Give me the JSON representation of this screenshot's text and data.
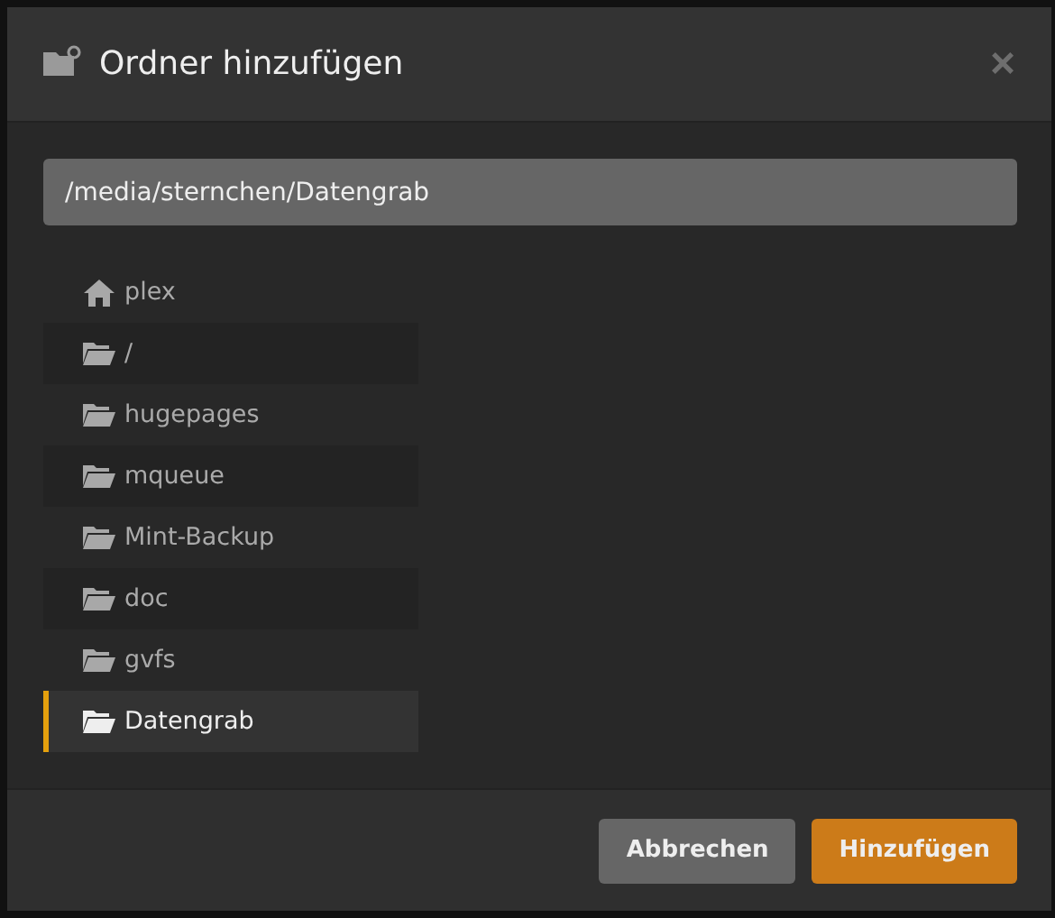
{
  "dialog": {
    "title": "Ordner hinzufügen",
    "close": "×"
  },
  "path_field": {
    "value": "/media/sternchen/Datengrab"
  },
  "folders": [
    {
      "name": "plex",
      "kind": "home",
      "selected": false
    },
    {
      "name": "/",
      "kind": "folder",
      "selected": false
    },
    {
      "name": "hugepages",
      "kind": "folder",
      "selected": false
    },
    {
      "name": "mqueue",
      "kind": "folder",
      "selected": false
    },
    {
      "name": "Mint-Backup",
      "kind": "folder",
      "selected": false
    },
    {
      "name": "doc",
      "kind": "folder",
      "selected": false
    },
    {
      "name": "gvfs",
      "kind": "folder",
      "selected": false
    },
    {
      "name": "Datengrab",
      "kind": "folder",
      "selected": true
    }
  ],
  "buttons": [
    {
      "label": "Abbrechen",
      "kind": "secondary"
    },
    {
      "label": "Hinzufügen",
      "kind": "primary"
    }
  ]
}
